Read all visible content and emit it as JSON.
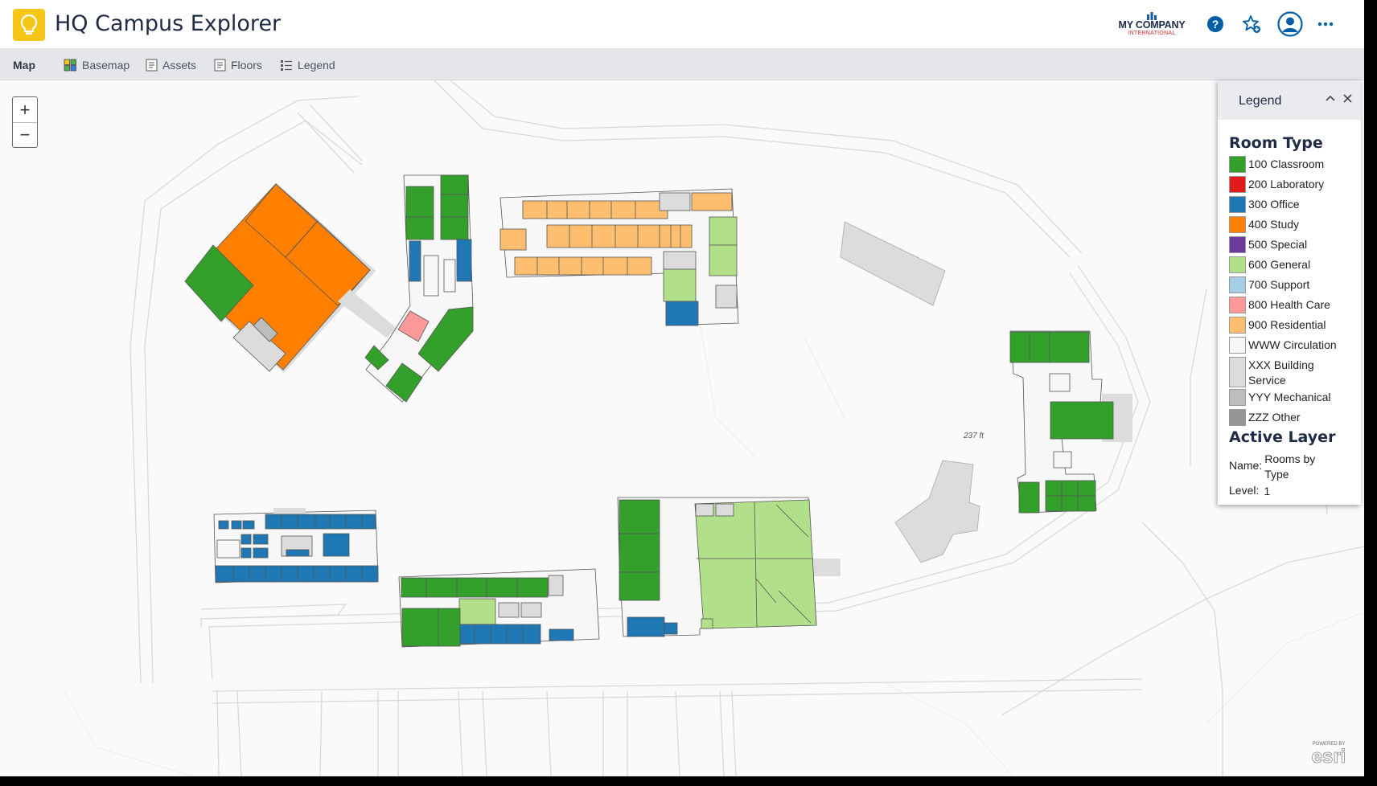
{
  "header": {
    "title": "HQ Campus Explorer",
    "brand_main": "MY COMPANY",
    "brand_sub": "INTERNATIONAL"
  },
  "toolbar": {
    "section": "Map",
    "buttons": [
      "Basemap",
      "Assets",
      "Floors",
      "Legend"
    ]
  },
  "map": {
    "zoom_in": "+",
    "zoom_out": "−",
    "scale_label": "237 ft",
    "attribution": "POWERED BY esri"
  },
  "legend": {
    "title": "Legend",
    "room_type_heading": "Room Type",
    "items": [
      {
        "label": "100 Classroom",
        "color": "#33a02c"
      },
      {
        "label": "200 Laboratory",
        "color": "#e31a1c"
      },
      {
        "label": "300 Office",
        "color": "#1f78b4"
      },
      {
        "label": "400 Study",
        "color": "#ff7f00"
      },
      {
        "label": "500 Special",
        "color": "#6a3d9a"
      },
      {
        "label": "600 General",
        "color": "#b2df8a"
      },
      {
        "label": "700 Support",
        "color": "#a6cee3"
      },
      {
        "label": "800 Health Care",
        "color": "#fb9a99"
      },
      {
        "label": "900 Residential",
        "color": "#fdbf6f"
      },
      {
        "label": "WWW Circulation",
        "color": "#f7f7f7"
      },
      {
        "label": "XXX Building Service",
        "color": "#dcdcdc"
      },
      {
        "label": "YYY Mechanical",
        "color": "#bdbdbd"
      },
      {
        "label": "ZZZ Other",
        "color": "#969696"
      }
    ],
    "active_layer_heading": "Active Layer",
    "name_key": "Name:",
    "name_value": "Rooms by Type",
    "level_key": "Level:",
    "level_value": "1"
  },
  "colors": {
    "classroom": "#33a02c",
    "office": "#1f78b4",
    "study": "#ff7f00",
    "general": "#b2df8a",
    "health": "#fb9a99",
    "residential": "#fdbf6f",
    "circulation": "#f7f7f7",
    "service": "#dcdcdc",
    "mechanical": "#bdbdbd",
    "accent": "#005ea8",
    "logo": "#f5c518"
  }
}
